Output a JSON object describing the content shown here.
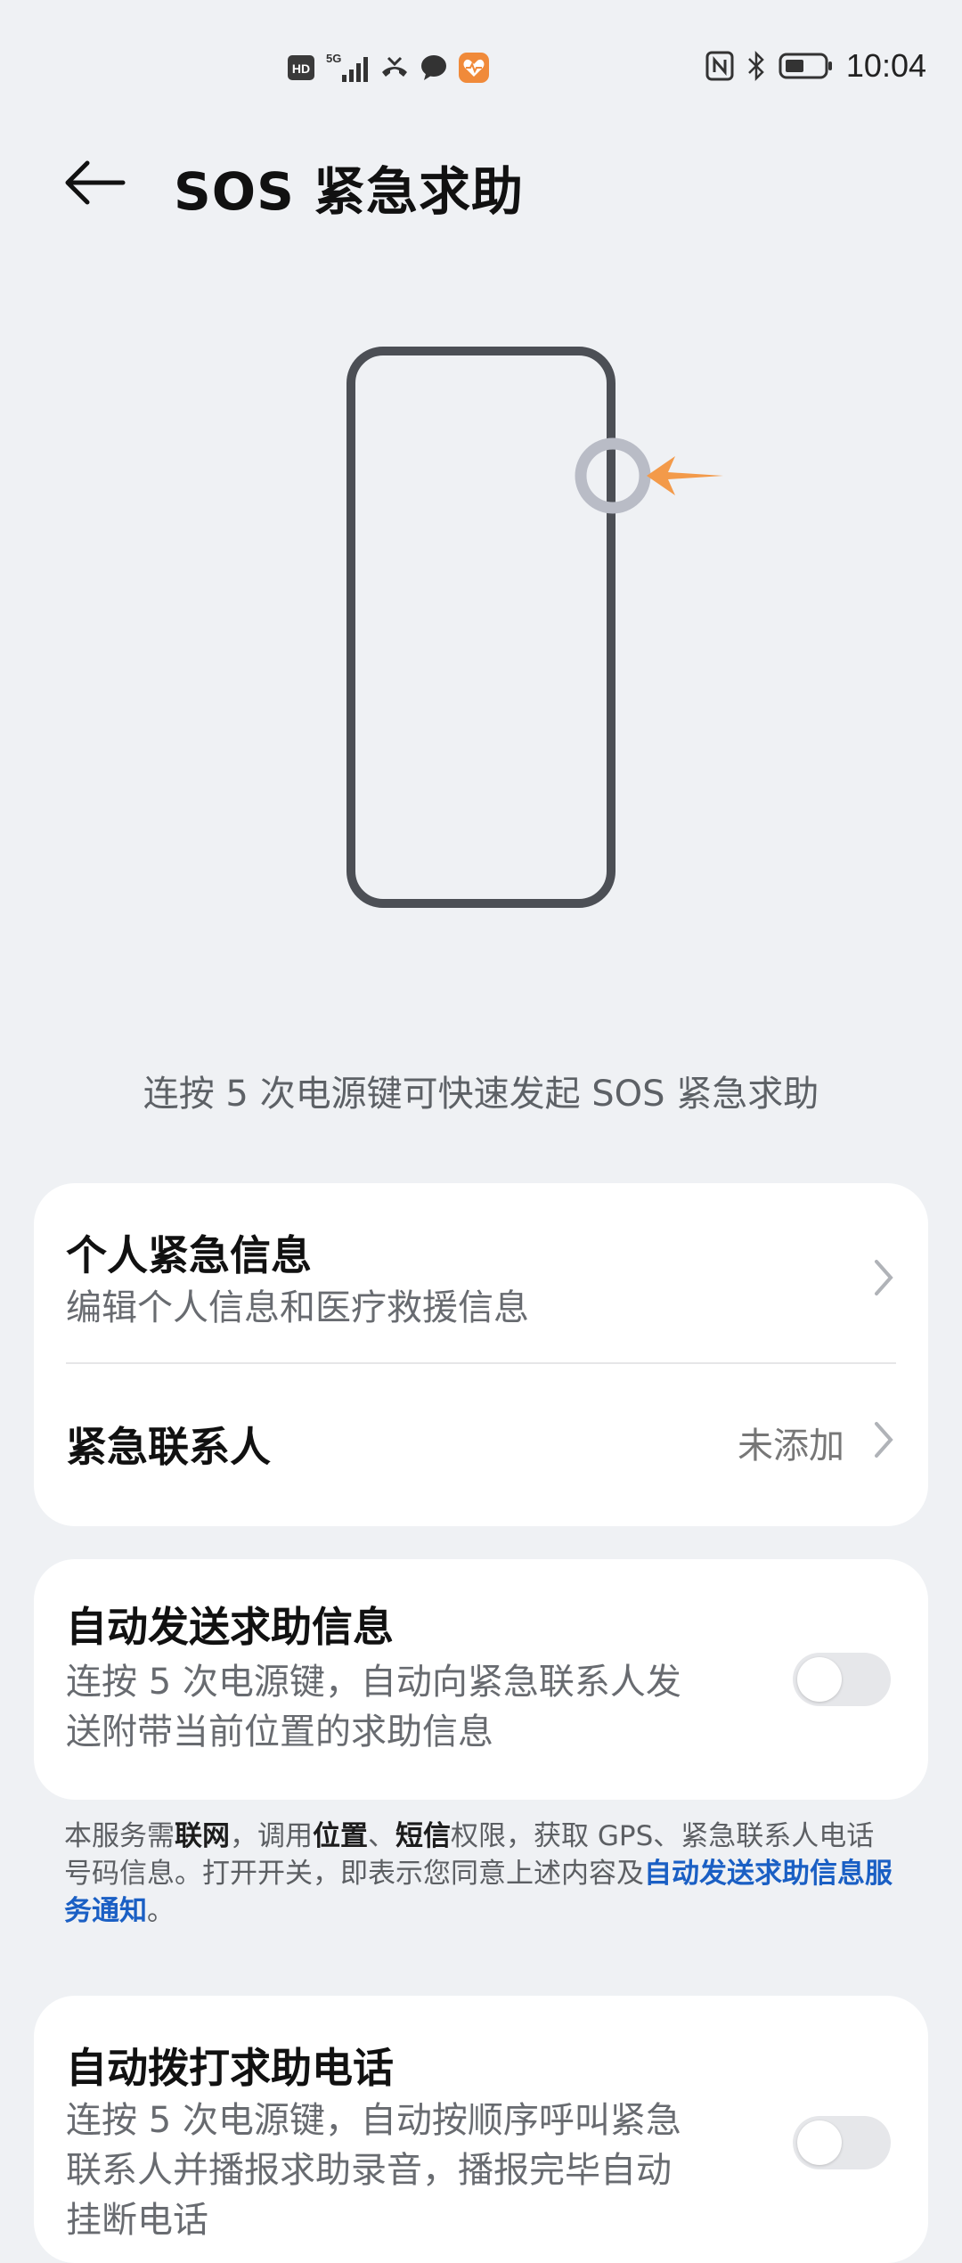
{
  "status_bar": {
    "time": "10:04",
    "left_icons": [
      "hd-icon",
      "5g-signal-icon",
      "missed-call-icon",
      "chat-icon",
      "health-app-icon"
    ],
    "network_label": "5G",
    "hd_label": "HD",
    "right_icons": [
      "nfc-icon",
      "bluetooth-icon",
      "battery-icon"
    ]
  },
  "header": {
    "title": "SOS 紧急求助"
  },
  "illustration": {
    "arrow_color": "#f39a4a",
    "ring_color": "#b9bcc6"
  },
  "intro_caption": "连按 5 次电源键可快速发起 SOS 紧急求助",
  "card1": {
    "personal_info": {
      "title": "个人紧急信息",
      "subtitle": "编辑个人信息和医疗救援信息"
    },
    "emergency_contacts": {
      "title": "紧急联系人",
      "value": "未添加"
    }
  },
  "card2": {
    "title": "自动发送求助信息",
    "subtitle_line1": "连按 5 次电源键，自动向紧急联系人发",
    "subtitle_line2": "送附带当前位置的求助信息",
    "toggle_on": false
  },
  "notice": {
    "p1": "本服务需",
    "b1": "联网",
    "p2": "，调用",
    "b2": "位置",
    "p3": "、",
    "b3": "短信",
    "p4": "权限，获取 GPS、紧急联系人电话号码信息。打开开关，即表示您同意上述内容及",
    "link": "自动发送求助信息服务通知",
    "p5": "。"
  },
  "card3": {
    "title": "自动拨打求助电话",
    "subtitle_line1": "连按 5 次电源键，自动按顺序呼叫紧急",
    "subtitle_line2": "联系人并播报求助录音，播报完毕自动",
    "subtitle_line3": "挂断电话",
    "toggle_on": false
  }
}
